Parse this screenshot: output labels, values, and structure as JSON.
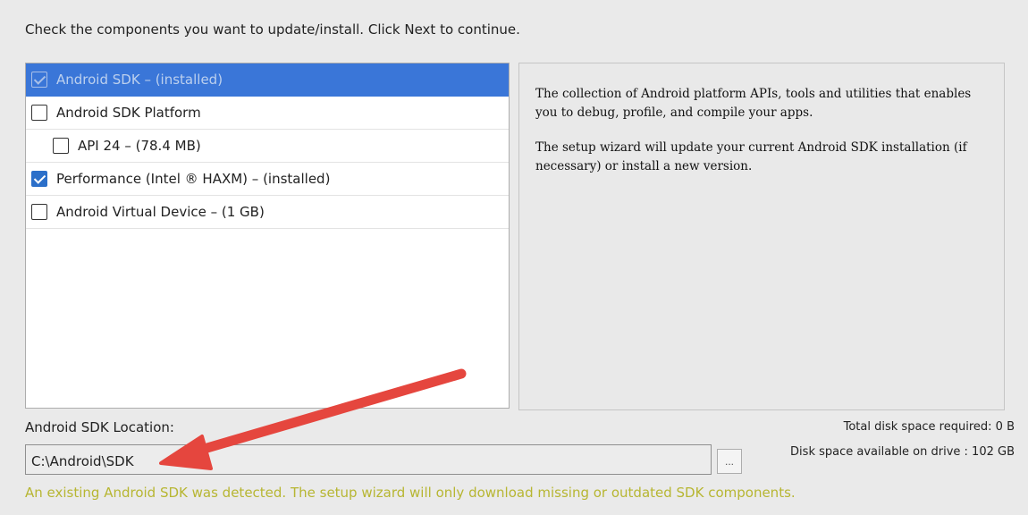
{
  "instruction": "Check the components you want to update/install. Click Next to continue.",
  "components": [
    {
      "label": "Android SDK – (installed)",
      "checked": true,
      "selected": true,
      "indent": false
    },
    {
      "label": "Android SDK Platform",
      "checked": false,
      "selected": false,
      "indent": false
    },
    {
      "label": "API 24 – (78.4 MB)",
      "checked": false,
      "selected": false,
      "indent": true
    },
    {
      "label": "Performance (Intel ® HAXM) – (installed)",
      "checked": true,
      "selected": false,
      "indent": false
    },
    {
      "label": "Android Virtual Device – (1 GB)",
      "checked": false,
      "selected": false,
      "indent": false
    }
  ],
  "description": {
    "paragraph1": "The collection of Android platform APIs, tools and utilities that enables you to debug, profile, and compile your apps.",
    "paragraph2": "The setup wizard will update your current Android SDK installation (if necessary) or install a new version."
  },
  "sdk_location": {
    "label": "Android SDK Location:",
    "value": "C:\\Android\\SDK",
    "browse_label": "..."
  },
  "disk": {
    "required": "Total disk space required: 0 B",
    "available": "Disk space available on drive : 102 GB"
  },
  "notice": "An existing Android SDK was detected. The setup wizard will only download missing or outdated SDK components.",
  "colors": {
    "selection": "#3a76d8",
    "notice": "#b7b632",
    "arrow": "#e5463e"
  }
}
